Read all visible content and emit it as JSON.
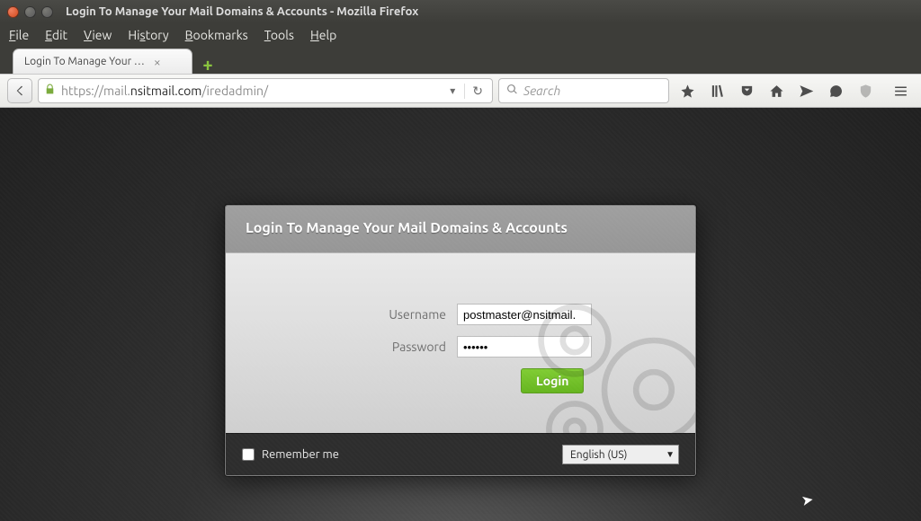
{
  "window": {
    "title": "Login To Manage Your Mail Domains & Accounts - Mozilla Firefox"
  },
  "menu": {
    "file": "File",
    "edit": "Edit",
    "view": "View",
    "history": "History",
    "bookmarks": "Bookmarks",
    "tools": "Tools",
    "help": "Help"
  },
  "tab": {
    "title": "Login To Manage Your …"
  },
  "url": {
    "prefix": "https://mail.",
    "host": "nsitmail.com",
    "path": "/iredadmin/"
  },
  "search": {
    "placeholder": "Search"
  },
  "login": {
    "heading": "Login To Manage Your Mail Domains & Accounts",
    "username_label": "Username",
    "username_value": "postmaster@nsitmail.",
    "password_label": "Password",
    "password_value": "••••••",
    "login_btn": "Login",
    "remember": "Remember me",
    "language": "English (US)"
  }
}
